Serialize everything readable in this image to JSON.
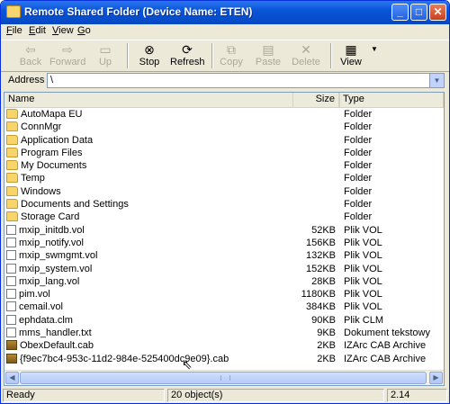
{
  "window": {
    "title": "Remote Shared Folder (Device Name: ETEN)"
  },
  "menu": [
    {
      "label": "File",
      "u": "F",
      "rest": "ile"
    },
    {
      "label": "Edit",
      "u": "E",
      "rest": "dit"
    },
    {
      "label": "View",
      "u": "V",
      "rest": "iew"
    },
    {
      "label": "Go",
      "u": "G",
      "rest": "o"
    }
  ],
  "toolbar": {
    "back": "Back",
    "forward": "Forward",
    "up": "Up",
    "stop": "Stop",
    "refresh": "Refresh",
    "copy": "Copy",
    "paste": "Paste",
    "delete": "Delete",
    "view": "View"
  },
  "address": {
    "label": "Address",
    "value": "\\"
  },
  "columns": {
    "name": "Name",
    "size": "Size",
    "type": "Type"
  },
  "files": [
    {
      "name": "AutoMapa EU",
      "size": "",
      "type": "Folder",
      "icon": "folder-icon"
    },
    {
      "name": "ConnMgr",
      "size": "",
      "type": "Folder",
      "icon": "folder-icon"
    },
    {
      "name": "Application Data",
      "size": "",
      "type": "Folder",
      "icon": "folder-icon"
    },
    {
      "name": "Program Files",
      "size": "",
      "type": "Folder",
      "icon": "folder-icon"
    },
    {
      "name": "My Documents",
      "size": "",
      "type": "Folder",
      "icon": "folder-icon"
    },
    {
      "name": "Temp",
      "size": "",
      "type": "Folder",
      "icon": "folder-icon"
    },
    {
      "name": "Windows",
      "size": "",
      "type": "Folder",
      "icon": "folder-icon"
    },
    {
      "name": "Documents and Settings",
      "size": "",
      "type": "Folder",
      "icon": "folder-icon"
    },
    {
      "name": "Storage Card",
      "size": "",
      "type": "Folder",
      "icon": "folder-icon"
    },
    {
      "name": "mxip_initdb.vol",
      "size": "52KB",
      "type": "Plik VOL",
      "icon": "file-icon"
    },
    {
      "name": "mxip_notify.vol",
      "size": "156KB",
      "type": "Plik VOL",
      "icon": "file-icon"
    },
    {
      "name": "mxip_swmgmt.vol",
      "size": "132KB",
      "type": "Plik VOL",
      "icon": "file-icon"
    },
    {
      "name": "mxip_system.vol",
      "size": "152KB",
      "type": "Plik VOL",
      "icon": "file-icon"
    },
    {
      "name": "mxip_lang.vol",
      "size": "28KB",
      "type": "Plik VOL",
      "icon": "file-icon"
    },
    {
      "name": "pim.vol",
      "size": "1180KB",
      "type": "Plik VOL",
      "icon": "file-icon"
    },
    {
      "name": "cemail.vol",
      "size": "384KB",
      "type": "Plik VOL",
      "icon": "file-icon"
    },
    {
      "name": "ephdata.clm",
      "size": "90KB",
      "type": "Plik CLM",
      "icon": "file-icon"
    },
    {
      "name": "mms_handler.txt",
      "size": "9KB",
      "type": "Dokument tekstowy",
      "icon": "text-file-icon"
    },
    {
      "name": "ObexDefault.cab",
      "size": "2KB",
      "type": "IZArc CAB Archive",
      "icon": "cab-icon"
    },
    {
      "name": "{f9ec7bc4-953c-11d2-984e-525400dc9e09}.cab",
      "size": "2KB",
      "type": "IZArc CAB Archive",
      "icon": "cab-icon"
    }
  ],
  "status": {
    "text": "Ready",
    "count": "20 object(s)",
    "right": "2.14"
  }
}
